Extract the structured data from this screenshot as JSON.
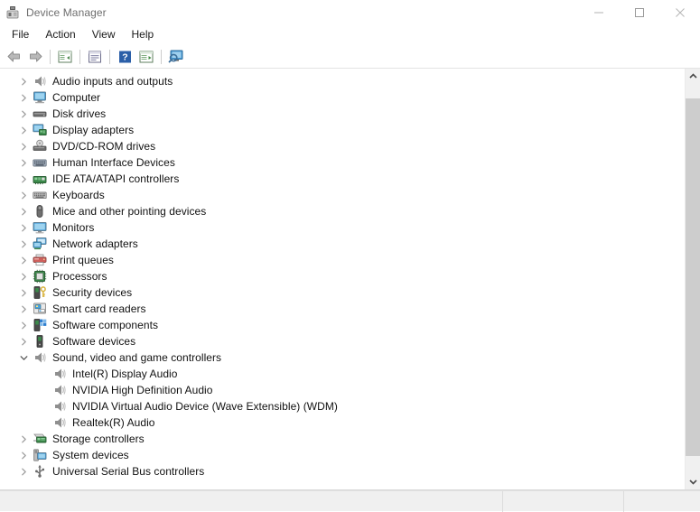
{
  "window": {
    "title": "Device Manager",
    "icon": "device-manager-icon",
    "controls": [
      {
        "name": "minimize-button",
        "glyph": "minimize"
      },
      {
        "name": "maximize-button",
        "glyph": "maximize"
      },
      {
        "name": "close-button",
        "glyph": "close"
      }
    ]
  },
  "menubar": {
    "items": [
      {
        "label": "File"
      },
      {
        "label": "Action"
      },
      {
        "label": "View"
      },
      {
        "label": "Help"
      }
    ]
  },
  "toolbar": {
    "buttons": [
      {
        "name": "back-button",
        "icon": "back-arrow-icon"
      },
      {
        "name": "forward-button",
        "icon": "forward-arrow-icon"
      },
      {
        "name": "separator-1",
        "icon": "separator"
      },
      {
        "name": "show-hide-console-tree-button",
        "icon": "console-tree-icon"
      },
      {
        "name": "separator-2",
        "icon": "separator"
      },
      {
        "name": "properties-button",
        "icon": "properties-icon"
      },
      {
        "name": "separator-3",
        "icon": "separator"
      },
      {
        "name": "help-button",
        "icon": "help-icon"
      },
      {
        "name": "update-driver-button",
        "icon": "update-driver-icon"
      },
      {
        "name": "separator-4",
        "icon": "separator"
      },
      {
        "name": "scan-for-hardware-changes-button",
        "icon": "scan-hardware-icon"
      }
    ]
  },
  "tree": {
    "rows": [
      {
        "label": "Audio inputs and outputs",
        "icon": "speaker-icon",
        "expander": "collapsed",
        "level": 0
      },
      {
        "label": "Computer",
        "icon": "computer-icon",
        "expander": "collapsed",
        "level": 0
      },
      {
        "label": "Disk drives",
        "icon": "disk-drive-icon",
        "expander": "collapsed",
        "level": 0
      },
      {
        "label": "Display adapters",
        "icon": "display-adapter-icon",
        "expander": "collapsed",
        "level": 0
      },
      {
        "label": "DVD/CD-ROM drives",
        "icon": "dvd-drive-icon",
        "expander": "collapsed",
        "level": 0
      },
      {
        "label": "Human Interface Devices",
        "icon": "hid-icon",
        "expander": "collapsed",
        "level": 0
      },
      {
        "label": "IDE ATA/ATAPI controllers",
        "icon": "ide-controller-icon",
        "expander": "collapsed",
        "level": 0
      },
      {
        "label": "Keyboards",
        "icon": "keyboard-icon",
        "expander": "collapsed",
        "level": 0
      },
      {
        "label": "Mice and other pointing devices",
        "icon": "mouse-icon",
        "expander": "collapsed",
        "level": 0
      },
      {
        "label": "Monitors",
        "icon": "monitor-icon",
        "expander": "collapsed",
        "level": 0
      },
      {
        "label": "Network adapters",
        "icon": "network-adapter-icon",
        "expander": "collapsed",
        "level": 0
      },
      {
        "label": "Print queues",
        "icon": "printer-icon",
        "expander": "collapsed",
        "level": 0
      },
      {
        "label": "Processors",
        "icon": "processor-icon",
        "expander": "collapsed",
        "level": 0
      },
      {
        "label": "Security devices",
        "icon": "security-device-icon",
        "expander": "collapsed",
        "level": 0
      },
      {
        "label": "Smart card readers",
        "icon": "smart-card-reader-icon",
        "expander": "collapsed",
        "level": 0
      },
      {
        "label": "Software components",
        "icon": "software-component-icon",
        "expander": "collapsed",
        "level": 0
      },
      {
        "label": "Software devices",
        "icon": "software-device-icon",
        "expander": "collapsed",
        "level": 0
      },
      {
        "label": "Sound, video and game controllers",
        "icon": "speaker-icon",
        "expander": "expanded",
        "level": 0
      },
      {
        "label": "Intel(R) Display Audio",
        "icon": "speaker-icon",
        "expander": "none",
        "level": 1
      },
      {
        "label": "NVIDIA High Definition Audio",
        "icon": "speaker-icon",
        "expander": "none",
        "level": 1
      },
      {
        "label": "NVIDIA Virtual Audio Device (Wave Extensible) (WDM)",
        "icon": "speaker-icon",
        "expander": "none",
        "level": 1
      },
      {
        "label": "Realtek(R) Audio",
        "icon": "speaker-icon",
        "expander": "none",
        "level": 1
      },
      {
        "label": "Storage controllers",
        "icon": "storage-controller-icon",
        "expander": "collapsed",
        "level": 0
      },
      {
        "label": "System devices",
        "icon": "system-device-icon",
        "expander": "collapsed",
        "level": 0
      },
      {
        "label": "Universal Serial Bus controllers",
        "icon": "usb-controller-icon",
        "expander": "collapsed",
        "level": 0
      }
    ]
  },
  "scrollbar": {
    "up_icon": "scroll-up-arrow-icon",
    "down_icon": "scroll-down-arrow-icon"
  },
  "statusbar": {
    "main_text": "",
    "segment_1_text": "",
    "segment_2_text": ""
  },
  "colors": {
    "text": "#111111",
    "title_text": "#6d6d6d",
    "window_bg": "#ffffff",
    "statusbar_bg": "#f0f0f0",
    "scroll_thumb": "#cdcdcd",
    "accent_blue": "#2b6cb4"
  }
}
